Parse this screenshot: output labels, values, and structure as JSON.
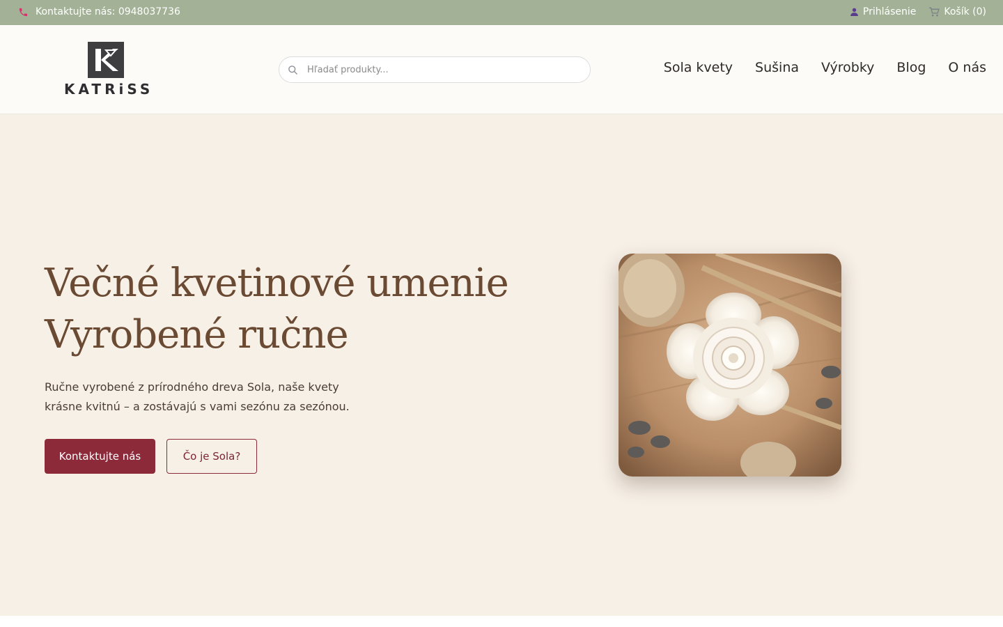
{
  "topbar": {
    "contact_text": "Kontaktujte nás: 0948037736",
    "login_label": "Prihlásenie",
    "cart_label": "Košík (0)",
    "icons": {
      "phone": "phone-icon",
      "user": "user-icon",
      "cart": "cart-icon"
    },
    "bg_color": "#a3b297",
    "phone_icon_color": "#d6336c",
    "user_icon_color": "#5a3c8c"
  },
  "header": {
    "logo_text": "KATRiSS",
    "search": {
      "placeholder": "Hľadať produkty...",
      "value": ""
    },
    "nav": [
      {
        "label": "Sola kvety"
      },
      {
        "label": "Sušina"
      },
      {
        "label": "Výrobky"
      },
      {
        "label": "Blog"
      },
      {
        "label": "O nás"
      }
    ]
  },
  "hero": {
    "title_line1": "Večné kvetinové umenie",
    "title_line2": "Vyrobené ručne",
    "text": "Ručne vyrobené z prírodného dreva Sola, naše kvety krásne kvitnú – a zostávajú s vami sezónu za sezónou.",
    "primary_button": "Kontaktujte nás",
    "secondary_button": "Čo je Sola?",
    "image": "sola-flower-photo",
    "colors": {
      "title": "#6b4a33",
      "bg": "#f7f0e7",
      "accent": "#8c2a3a"
    }
  }
}
